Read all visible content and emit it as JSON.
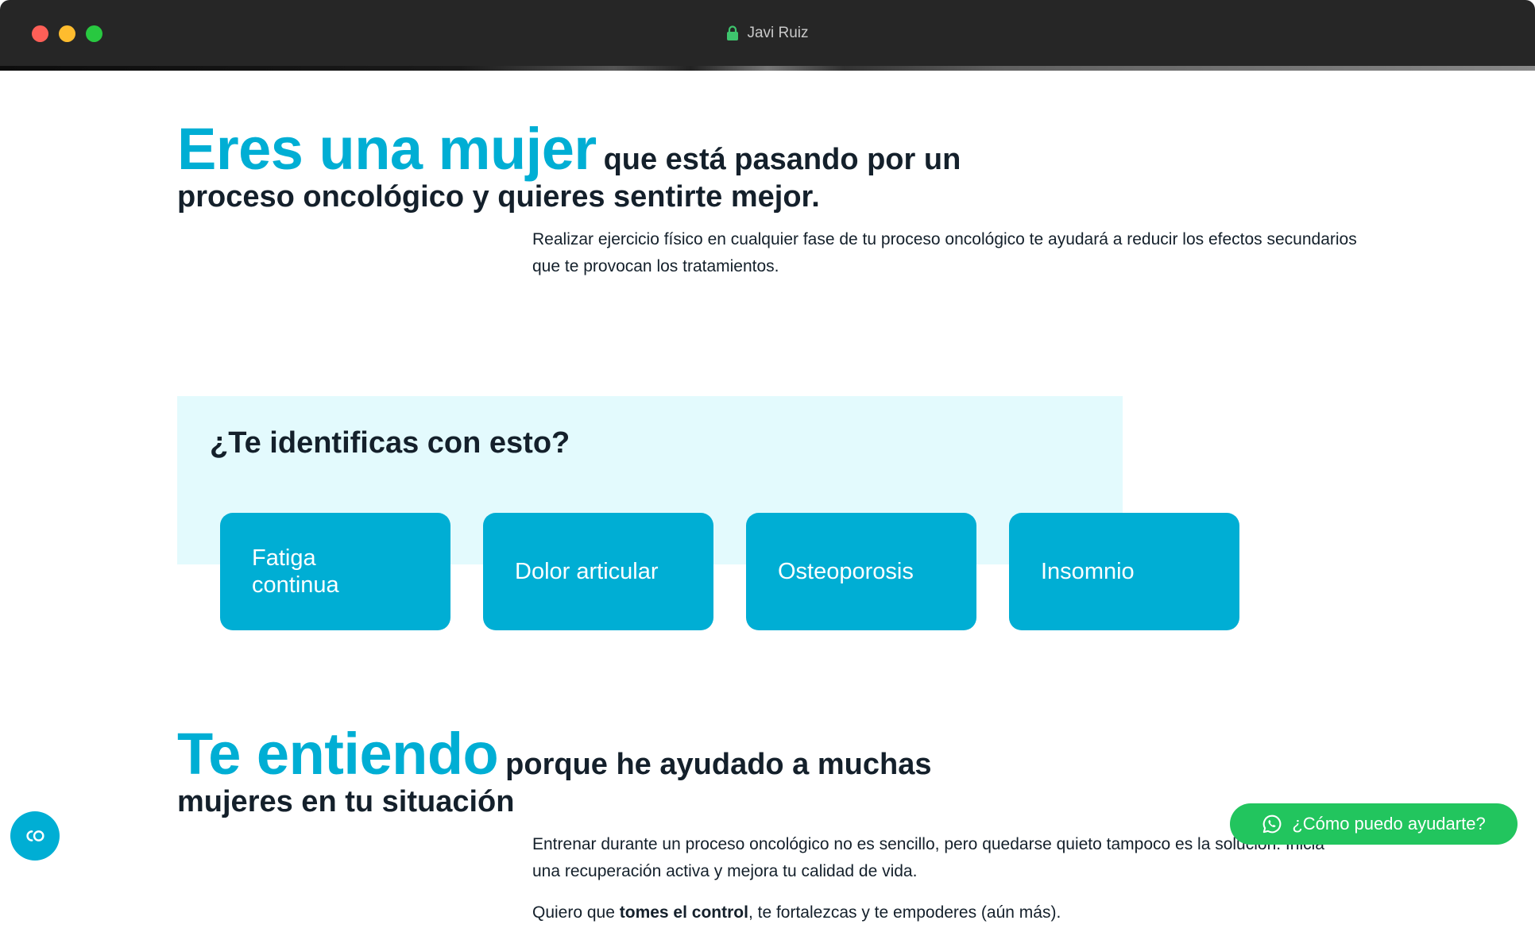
{
  "window": {
    "title": "Javi Ruiz"
  },
  "hero": {
    "highlight": "Eres una mujer",
    "rest": "que está pasando por un proceso oncológico y quieres sentirte mejor.",
    "lead": "Realizar ejercicio físico en cualquier fase de tu proceso oncológico te ayudará a reducir los efectos secundarios que te provocan los tratamientos."
  },
  "identify": {
    "title": "¿Te identificas con esto?",
    "cards": [
      "Fatiga continua",
      "Dolor articular",
      "Osteoporosis",
      "Insomnio"
    ]
  },
  "understand": {
    "highlight": "Te entiendo",
    "rest": "porque he ayudado a muchas mujeres en tu situación",
    "lead": "Entrenar durante un proceso oncológico no es sencillo, pero quedarse quieto tampoco es la solución. Inicia una recuperación activa y mejora tu calidad de vida.",
    "line2_pre": "Quiero que ",
    "line2_bold": "tomes el control",
    "line2_post": ", te fortalezcas y te empoderes (aún más)."
  },
  "widgets": {
    "cookie_icon": "cookie-settings-icon",
    "whatsapp_label": "¿Cómo puedo ayudarte?",
    "whatsapp_icon": "whatsapp-icon"
  },
  "colors": {
    "accent": "#00aed4",
    "light_box": "#e3fafd",
    "text": "#14202b",
    "whatsapp": "#22c55e"
  }
}
